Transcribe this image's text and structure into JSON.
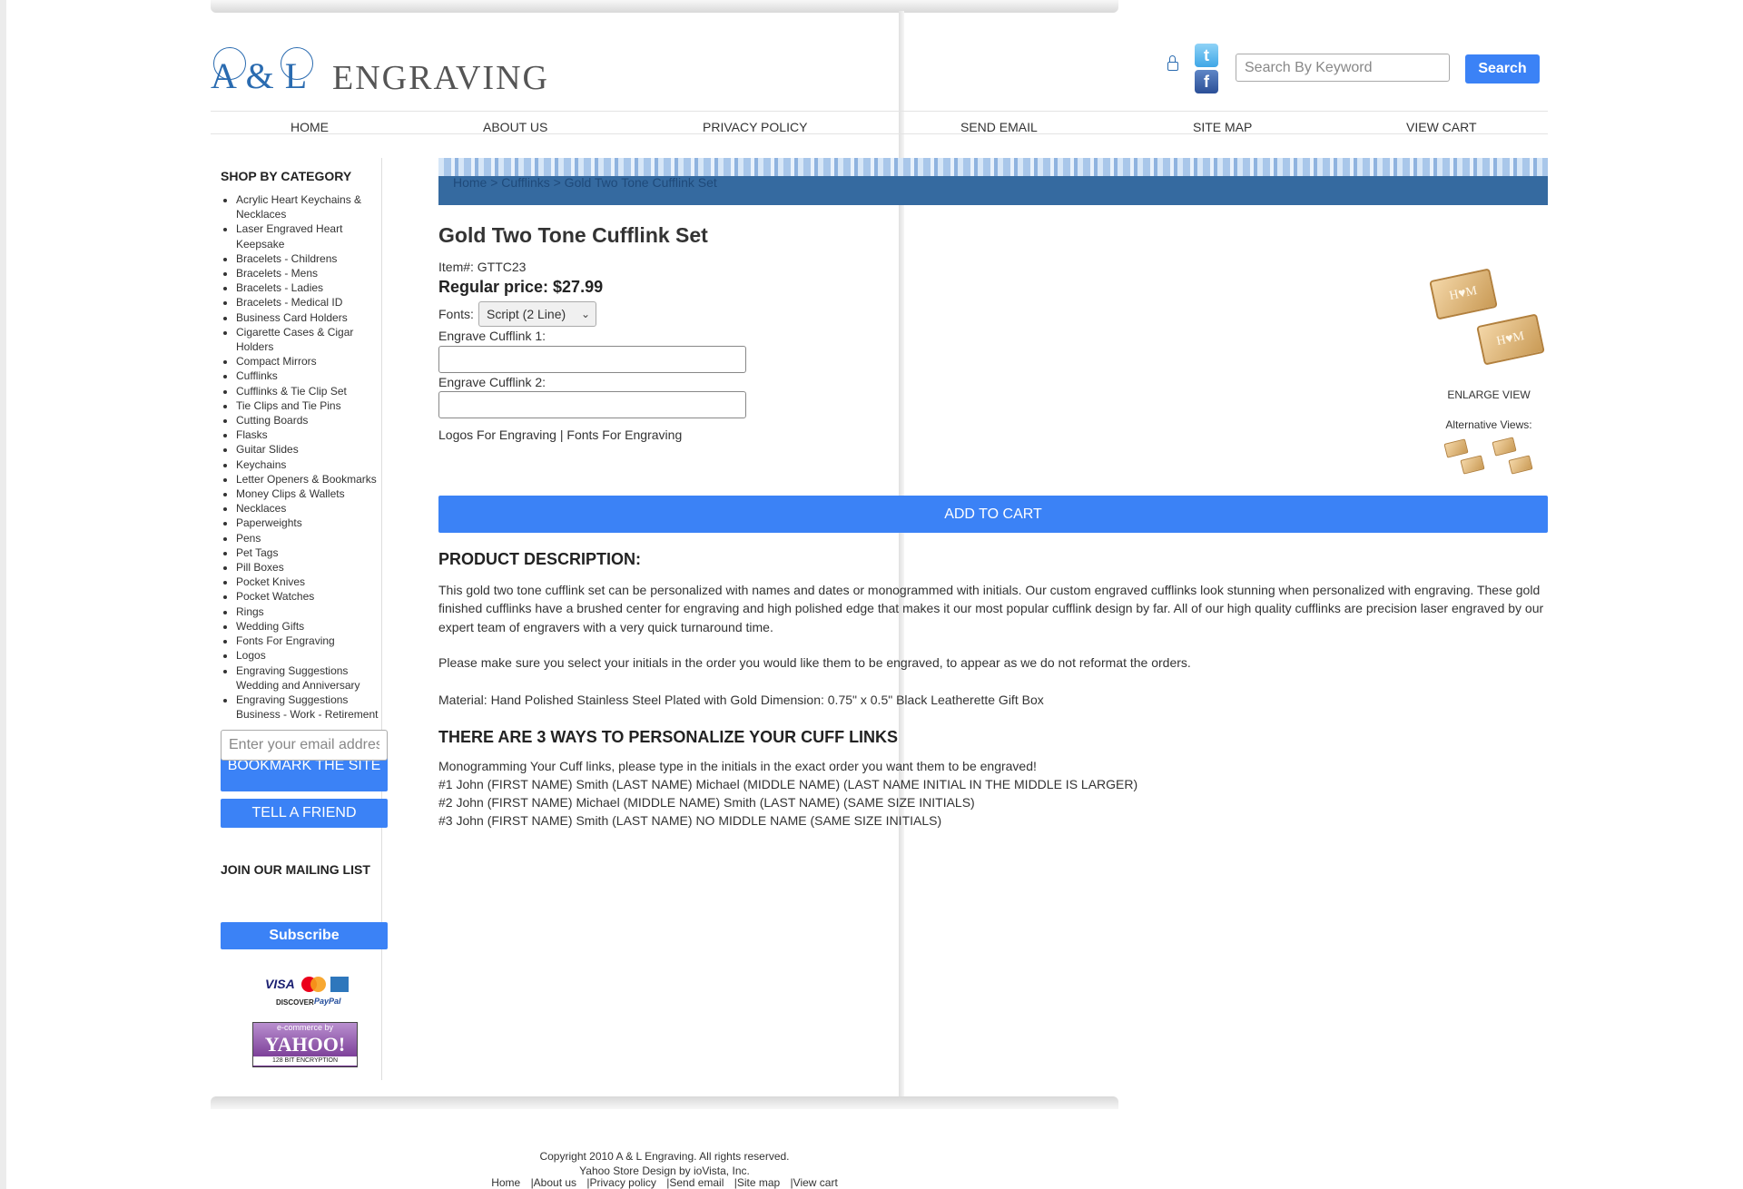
{
  "header": {
    "logo_initials": "A & L",
    "logo_word": "ENGRAVING",
    "search_placeholder": "Search By Keyword",
    "search_button": "Search",
    "social_icons": [
      "twitter-icon",
      "facebook-icon"
    ]
  },
  "nav": {
    "items": [
      "HOME",
      "ABOUT US",
      "PRIVACY POLICY",
      "SEND EMAIL",
      "SITE MAP",
      "VIEW CART"
    ]
  },
  "sidebar": {
    "title": "SHOP BY CATEGORY",
    "categories": [
      "Acrylic Heart Keychains & Necklaces",
      "Laser Engraved Heart Keepsake",
      "Bracelets - Childrens",
      "Bracelets - Mens",
      "Bracelets - Ladies",
      "Bracelets - Medical ID",
      "Business Card Holders",
      "Cigarette Cases & Cigar Holders",
      "Compact Mirrors",
      "Cufflinks",
      "Cufflinks & Tie Clip Set",
      "Tie Clips and Tie Pins",
      "Cutting Boards",
      "Flasks",
      "Guitar Slides",
      "Keychains",
      "Letter Openers & Bookmarks",
      "Money Clips & Wallets",
      "Necklaces",
      "Paperweights",
      "Pens",
      "Pet Tags",
      "Pill Boxes",
      "Pocket Knives",
      "Pocket Watches",
      "Rings",
      "Wedding Gifts",
      "Fonts For Engraving",
      "Logos",
      "Engraving Suggestions Wedding and Anniversary",
      "Engraving Suggestions Business - Work - Retirement"
    ],
    "bookmark_button": "BOOKMARK THE SITE",
    "tell_friend_button": "TELL A FRIEND",
    "mailing_title": "JOIN OUR MAILING LIST",
    "email_placeholder": "Enter your email address",
    "subscribe_button": "Subscribe",
    "payment": {
      "visa": "VISA",
      "discover": "DISCOVER",
      "paypal": "PayPal"
    },
    "yahoo_badge": {
      "line1": "e-commerce by",
      "line2": "YAHOO!",
      "line3": "128 BIT ENCRYPTION"
    }
  },
  "breadcrumb": "Home > Cufflinks > Gold Two Tone Cufflink Set",
  "product": {
    "title": "Gold Two Tone Cufflink Set",
    "item_number": "Item#: GTTC23",
    "price": "Regular price: $27.99",
    "fonts_label": "Fonts:",
    "font_selected": "Script (2 Line)",
    "engrave1_label": "Engrave Cufflink 1:",
    "engrave2_label": "Engrave Cufflink 2:",
    "link_logos": "Logos For Engraving",
    "link_separator": " | ",
    "link_fonts": "Fonts For Engraving",
    "image_monogram": "H♥M",
    "enlarge_view": "ENLARGE VIEW",
    "alternative_views": "Alternative Views:",
    "add_to_cart": "ADD TO CART"
  },
  "description": {
    "title": "PRODUCT DESCRIPTION:",
    "p1": "This gold two tone cufflink set can be personalized with names and dates or monogrammed with initials. Our custom engraved cufflinks look stunning when personalized with engraving. These gold finished cufflinks have a brushed center for engraving and high polished edge that makes it our most popular cufflink design by far. All of our high quality cufflinks are precision laser engraved by our expert team of engravers with a very quick turnaround time.",
    "p2": "Please make sure you select your initials in the order you would like them to be engraved, to appear as we do not reformat the orders.",
    "p3": "Material: Hand Polished Stainless Steel Plated with Gold Dimension: 0.75\" x 0.5\" Black Leatherette Gift Box",
    "ways_title": "THERE ARE 3 WAYS TO PERSONALIZE YOUR CUFF LINKS",
    "ways_intro": "Monogramming Your Cuff links, please type in the initials in the exact order you want them to be engraved!",
    "way1": "#1 John (FIRST NAME) Smith (LAST NAME) Michael (MIDDLE NAME) (LAST NAME INITIAL IN THE MIDDLE IS LARGER)",
    "way2": "#2 John (FIRST NAME) Michael (MIDDLE NAME) Smith (LAST NAME) (SAME SIZE INITIALS)",
    "way3": "#3 John (FIRST NAME) Smith (LAST NAME) NO MIDDLE NAME (SAME SIZE INITIALS)"
  },
  "footer": {
    "copyright": "Copyright 2010 A & L Engraving. All rights reserved.",
    "design": "Yahoo Store Design by ioVista, Inc.",
    "links": [
      "Home",
      "|About us",
      "|Privacy policy",
      "|Send email",
      "|Site map",
      "|View cart"
    ]
  },
  "colors": {
    "accent_button": "#3b82f6",
    "breadcrumb_bar": "#356aa0",
    "logo_blue": "#2a6bb0"
  }
}
